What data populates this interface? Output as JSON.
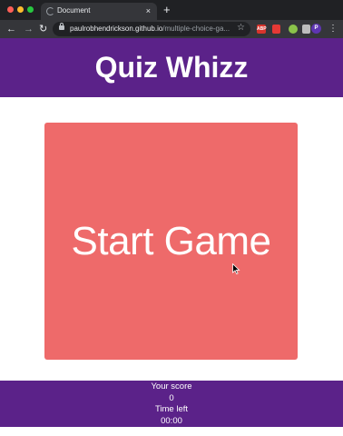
{
  "browser": {
    "tab_title": "Document",
    "tab_close": "×",
    "new_tab": "+",
    "url_host": "paulrobhendrickson.github.io",
    "url_path": "/multiple-choice-ga...",
    "back": "←",
    "forward": "→",
    "reload": "↻",
    "star": "☆",
    "ext_abp": "ABP",
    "profile_initial": "P",
    "menu": "⋮"
  },
  "header": {
    "title": "Quiz Whizz",
    "background": "#5b2289"
  },
  "main": {
    "start_button": "Start Game",
    "button_color": "#ee6a6a"
  },
  "footer": {
    "score_label": "Your score",
    "score_value": "0",
    "time_label": "Time left",
    "time_value": "00:00"
  }
}
